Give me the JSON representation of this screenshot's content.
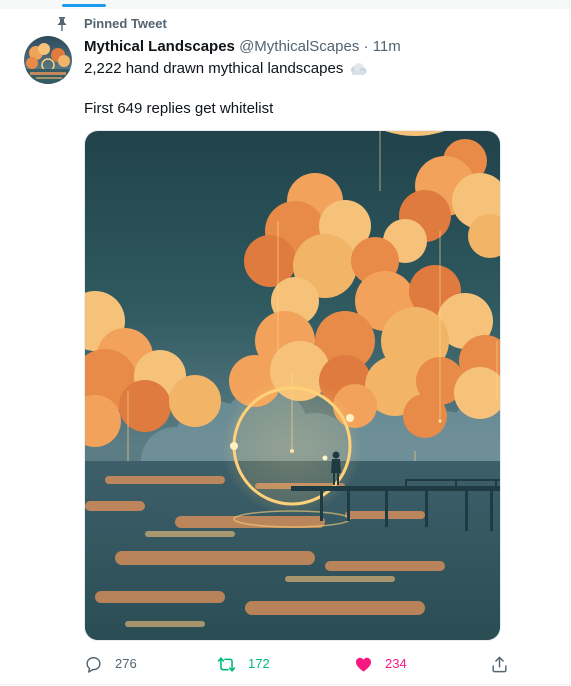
{
  "pinned": {
    "label": "Pinned Tweet",
    "icon": "pin-icon"
  },
  "author": {
    "display_name": "Mythical Landscapes",
    "handle": "@MythicalScapes",
    "separator": "·",
    "time": "11m"
  },
  "tweet": {
    "line1": "2,222 hand drawn mythical landscapes",
    "line1_emoji": "cloud-emoji",
    "line2": "First 649 replies get whitelist"
  },
  "actions": {
    "reply": {
      "count": "276",
      "icon": "reply-icon"
    },
    "retweet": {
      "count": "172",
      "icon": "retweet-icon"
    },
    "like": {
      "count": "234",
      "icon": "heart-icon"
    },
    "share": {
      "icon": "share-icon"
    }
  },
  "colors": {
    "accent": "#1d9bf0",
    "muted": "#536471",
    "retweet_green": "#00ba7c",
    "like_pink": "#f91880",
    "text": "#0f1419"
  }
}
